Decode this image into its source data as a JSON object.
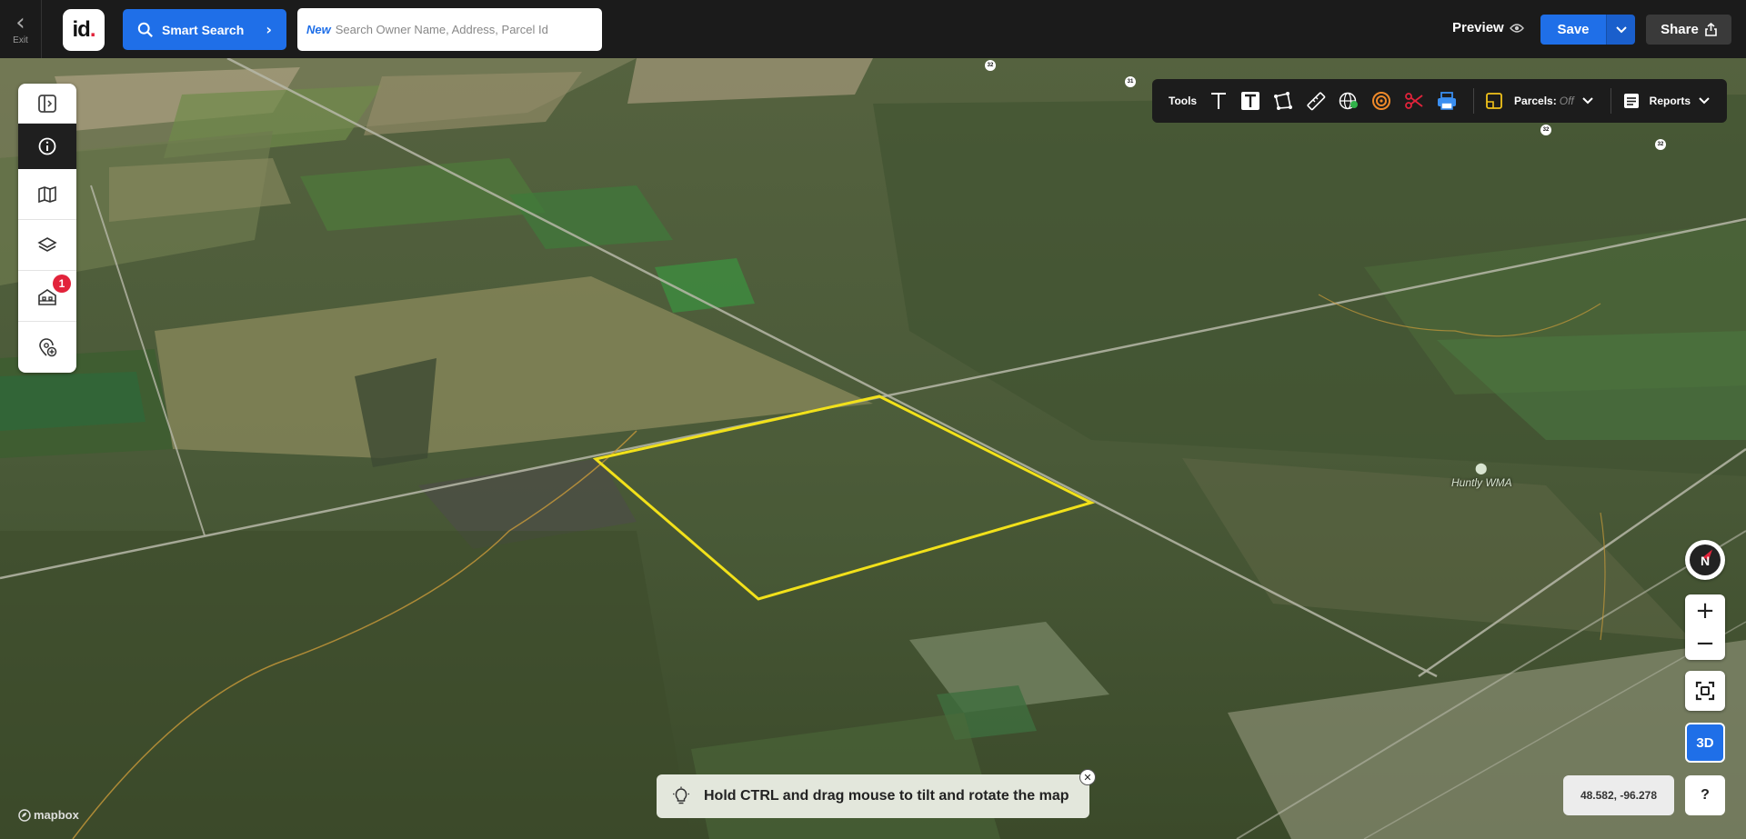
{
  "topbar": {
    "exit_label": "Exit",
    "logo_text": "id",
    "smart_search_label": "Smart Search",
    "search": {
      "new_tag": "New",
      "placeholder": "Search Owner Name, Address, Parcel Id"
    },
    "preview_label": "Preview",
    "save_label": "Save",
    "share_label": "Share"
  },
  "left_panel": {
    "items": [
      "panel-toggle-icon",
      "info-icon",
      "map-icon",
      "layers-icon",
      "buildings-icon",
      "add-location-icon"
    ],
    "badge_count": "1"
  },
  "toolbar": {
    "tools_label": "Tools",
    "parcels_label": "Parcels:",
    "parcels_state": "Off",
    "reports_label": "Reports"
  },
  "map": {
    "place_label": "Huntly WMA",
    "coords": "48.582, -96.278",
    "hint": "Hold CTRL and drag mouse to tilt and rotate the map",
    "attribution": "mapbox",
    "three_d_label": "3D",
    "help_label": "?",
    "compass_label": "N",
    "road_shields": [
      "32",
      "31",
      "32",
      "32"
    ]
  },
  "colors": {
    "accent": "#1f6fe8",
    "parcel_outline": "#f2e11a",
    "badge": "#e2233b"
  }
}
